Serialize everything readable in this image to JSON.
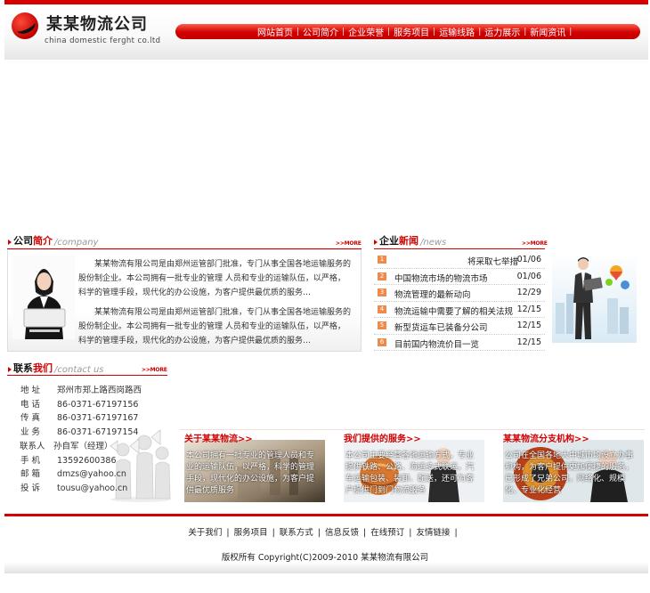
{
  "header": {
    "logo_cn": "某某物流公司",
    "logo_en": "china  domestic ferght co.ltd",
    "nav": [
      "网站首页",
      "公司简介",
      "企业荣誉",
      "服务项目",
      "运输线路",
      "运力展示",
      "新闻资讯"
    ]
  },
  "intro": {
    "title_1": "公司",
    "title_2": "简介",
    "title_en": "/company",
    "more": ">>MORE",
    "paragraphs": [
      "某某物流有限公司是由郑州运管部门批准，专门从事全国各地运输服务的股份制企业。本公司拥有一批专业的管理 人员和专业的运输队伍，以严格，科学的管理手段，现代化的办公设施，为客户提供最优质的服务…",
      "某某物流有限公司是由郑州运管部门批准，专门从事全国各地运输服务的股份制企业。本公司拥有一批专业的管理 人员和专业的运输队伍，以严格，科学的管理手段，现代化的办公设施，为客户提供最优质的服务…"
    ]
  },
  "news": {
    "title_1": "企业",
    "title_2": "新闻",
    "title_en": "/news",
    "more": ">>MORE",
    "items": [
      {
        "num": "1",
        "title": "将采取七举措",
        "date": "01/06"
      },
      {
        "num": "2",
        "title": "中国物流市场的物流市场",
        "date": "01/06"
      },
      {
        "num": "3",
        "title": "物流管理的最新动向",
        "date": "12/29"
      },
      {
        "num": "4",
        "title": "物流运输中需要了解的相关法规",
        "date": "12/15"
      },
      {
        "num": "5",
        "title": "新型货运车已装备分公司",
        "date": "12/15"
      },
      {
        "num": "6",
        "title": "目前国内物流价目一览",
        "date": "12/15"
      }
    ]
  },
  "contact": {
    "title_1": "联系",
    "title_2": "我们",
    "title_en": "/contact us",
    "more": ">>MORE",
    "rows": [
      {
        "label": "地    址",
        "value": "郑州市郑上路西岗路西"
      },
      {
        "label": "电    话",
        "value": "86-0371-67197156"
      },
      {
        "label": "传    真",
        "value": "86-0371-67197167"
      },
      {
        "label": "业    务",
        "value": "86-0371-67197154"
      },
      {
        "label": "联系人",
        "value": "孙自军（经理）"
      },
      {
        "label": "手    机",
        "value": "13592600386"
      },
      {
        "label": "邮    箱",
        "value": "dmzs@yahoo.cn"
      },
      {
        "label": "投    诉",
        "value": "tousu@yahoo.cn"
      }
    ]
  },
  "panels": [
    {
      "title": "关于某某物流>>",
      "text": "本公司拥有一批专业的管理人员和专业的运输队伍，以严格，科学的管理手段，现代化的办公设施，为客户提供最优质服务"
    },
    {
      "title": "我们提供的服务>>",
      "text": "本公司主要经营各地运输方式，专业提供铁路、公路、海运多式联运，汽车运输包装、装卸、配送，还可为客户提供门到门物流服务"
    },
    {
      "title": "某某物流分支机构>>",
      "text": "公司在全国各地大中城市均设立办事机构，为客户提供更加便捷的服务，已形成了兄弟公司，网络化、规模化、专业化经营"
    }
  ],
  "footer": {
    "links": [
      "关于我们",
      "服务项目",
      "联系方式",
      "信息反馈",
      "在线预订",
      "友情链接"
    ],
    "copyright": "版权所有 Copyright(C)2009-2010 某某物流有限公司"
  },
  "colors": {
    "accent": "#d60000",
    "news_badge": "#f08a4b"
  }
}
